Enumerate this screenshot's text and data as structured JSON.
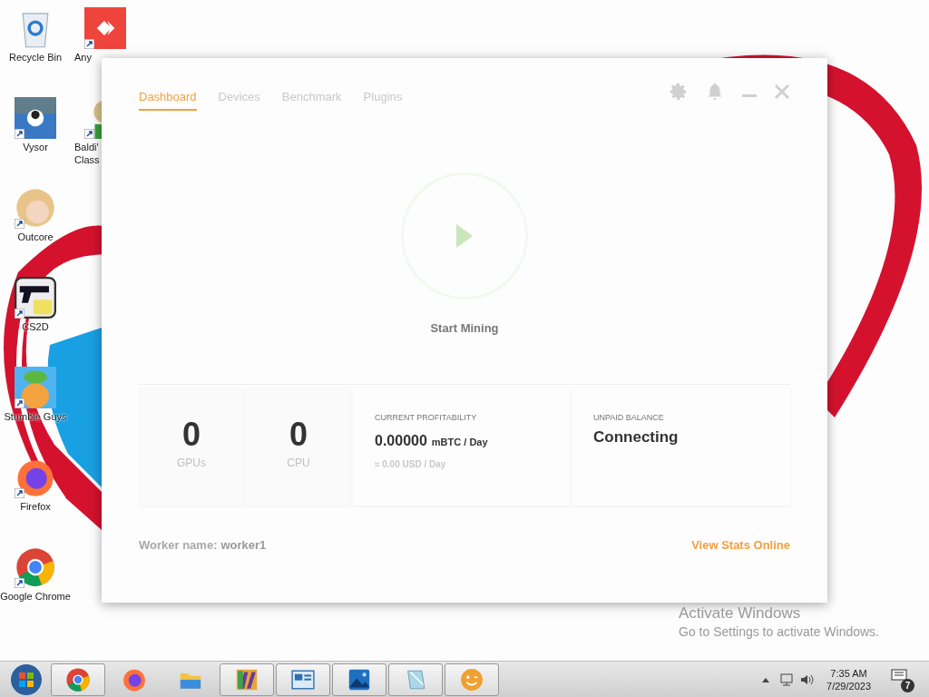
{
  "desktop_icons": [
    {
      "kind": "recycle",
      "label": "Recycle Bin",
      "shortcut": false
    },
    {
      "kind": "vysor",
      "label": "Vysor",
      "shortcut": true
    },
    {
      "kind": "face",
      "label": "Outcore",
      "shortcut": true
    },
    {
      "kind": "gun",
      "label": "CS2D",
      "shortcut": true
    },
    {
      "kind": "game",
      "label": "Stumble Guys",
      "shortcut": true
    },
    {
      "kind": "firefox",
      "label": "Firefox",
      "shortcut": true
    },
    {
      "kind": "chrome",
      "label": "Google Chrome",
      "shortcut": true
    }
  ],
  "desktop_icons_2": [
    {
      "kind": "anydesk",
      "label": "Any",
      "shortcut": true
    },
    {
      "kind": "person",
      "label": "Baldi' Class",
      "shortcut": true
    }
  ],
  "app": {
    "tabs": [
      {
        "label": "Dashboard",
        "selected": true
      },
      {
        "label": "Devices",
        "selected": false
      },
      {
        "label": "Benchmark",
        "selected": false
      },
      {
        "label": "Plugins",
        "selected": false
      }
    ],
    "start_label": "Start Mining",
    "stats": [
      {
        "value": "0",
        "label": "GPUs"
      },
      {
        "value": "0",
        "label": "CPU"
      }
    ],
    "profitability": {
      "heading": "CURRENT PROFITABILITY",
      "value": "0.00000",
      "unit": "mBTC / Day",
      "usd": "≈ 0.00 USD / Day"
    },
    "balance": {
      "heading": "UNPAID BALANCE",
      "value": "Connecting"
    },
    "worker_label": "Worker name:",
    "worker_name": "worker1",
    "stats_link": "View Stats Online"
  },
  "activation": {
    "title": "Activate Windows",
    "text": "Go to Settings to activate Windows."
  },
  "taskbar": {
    "apps": [
      {
        "kind": "chrome",
        "running": true
      },
      {
        "kind": "firefox",
        "running": false
      },
      {
        "kind": "folder",
        "running": false
      },
      {
        "kind": "archive",
        "running": true
      },
      {
        "kind": "panel",
        "running": true
      },
      {
        "kind": "photos",
        "running": true
      },
      {
        "kind": "notepad",
        "running": true
      },
      {
        "kind": "smiley",
        "running": true
      }
    ],
    "time": "7:35 AM",
    "date": "7/29/2023",
    "notifications": "7"
  }
}
